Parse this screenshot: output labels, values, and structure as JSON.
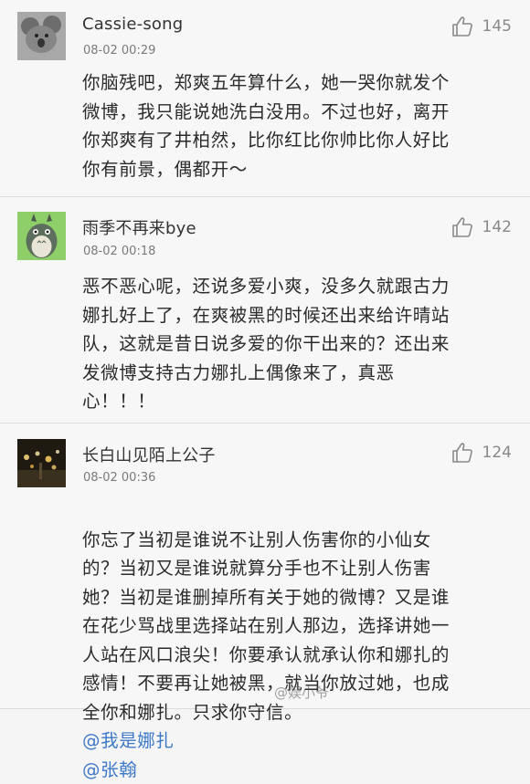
{
  "comments": [
    {
      "username": "Cassie-song",
      "timestamp": "08-02 00:29",
      "likes": "145",
      "avatar": "koala-avatar",
      "body": "你脑残吧，郑爽五年算什么，她一哭你就发个\n微博，我只能说她洗白没用。不过也好，离开\n你郑爽有了井柏然，比你红比你帅比你人好比\n你有前景，偶都开～"
    },
    {
      "username": "雨季不再来bye",
      "timestamp": "08-02 00:18",
      "likes": "142",
      "avatar": "totoro-avatar",
      "body": "恶不恶心呢，还说多爱小爽，没多久就跟古力\n娜扎好上了，在爽被黑的时候还出来给许晴站\n队，这就是昔日说多爱的你干出来的？还出来\n发微博支持古力娜扎上偶像来了，真恶\n心！！！"
    },
    {
      "username": "长白山见陌上公子",
      "timestamp": "08-02 00:36",
      "likes": "124",
      "avatar": "night-lights-avatar",
      "body": "你忘了当初是谁说不让别人伤害你的小仙女\n的？当初又是谁说就算分手也不让别人伤害\n她？当初是谁删掉所有关于她的微博？又是谁\n在花少骂战里选择站在别人那边，选择讲她一\n人站在风口浪尖！你要承认就承认你和娜扎的\n感情！不要再让她被黑，就当你放过她，也成\n全你和娜扎。只求你守信。",
      "mentions": [
        "@我是娜扎",
        "@张翰"
      ],
      "watermark": "@娱小爷"
    }
  ],
  "colors": {
    "background": "#f7f7f7",
    "text": "#2b2b2b",
    "meta": "#7a7a7a",
    "mention": "#3c78c8",
    "divider": "#dcdcdc"
  }
}
